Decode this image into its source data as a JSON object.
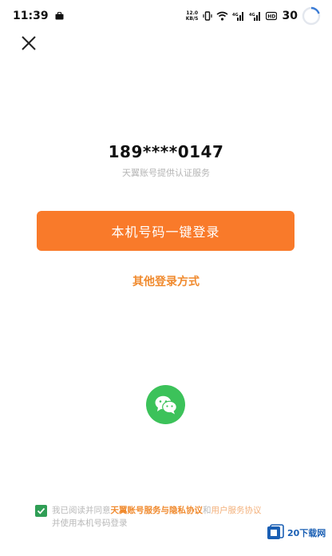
{
  "status_bar": {
    "time": "11:39",
    "net_speed_value": "12.0",
    "net_speed_unit": "KB/S",
    "battery": "30"
  },
  "login": {
    "phone_number": "189****0147",
    "auth_note": "天翼账号提供认证服务",
    "primary_button": "本机号码一键登录",
    "other_methods": "其他登录方式"
  },
  "agreement": {
    "prefix": "我已阅读并同意",
    "link1": "天翼账号服务与隐私协议",
    "conj": "和",
    "link2": "用户服务协议",
    "line2": "并使用本机号码登录"
  },
  "watermark": {
    "text": "20下载网"
  },
  "colors": {
    "accent": "#f97a2a",
    "link": "#f08a2e",
    "wechat": "#3cc25a",
    "checkbox": "#2f9e55"
  }
}
